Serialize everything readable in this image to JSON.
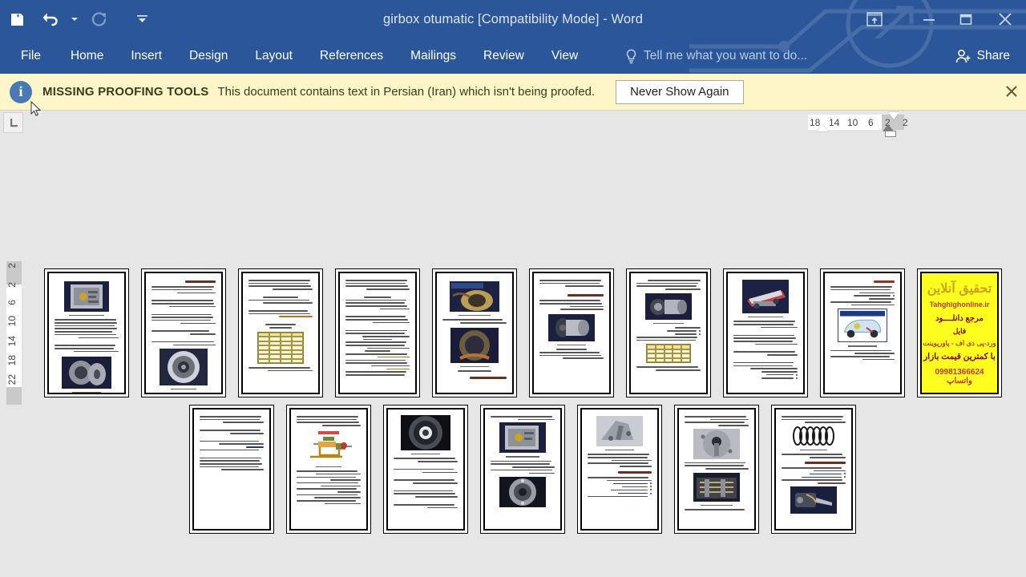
{
  "window": {
    "title": "girbox otumatic [Compatibility Mode] - Word",
    "quick_access": [
      {
        "name": "save",
        "icon": "save-icon",
        "label": "Save"
      },
      {
        "name": "undo",
        "icon": "undo-icon",
        "label": "Undo"
      },
      {
        "name": "undo-dropdown",
        "icon": "chevron-down-icon",
        "label": "Undo options"
      },
      {
        "name": "redo",
        "icon": "redo-icon",
        "label": "Redo"
      },
      {
        "name": "customize",
        "icon": "customize-qat-icon",
        "label": "Customize Quick Access Toolbar"
      }
    ],
    "controls": [
      {
        "name": "ribbon-display-options",
        "icon": "ribbon-display-icon",
        "label": "Ribbon Display Options"
      },
      {
        "name": "minimize",
        "icon": "minimize-icon",
        "label": "Minimize"
      },
      {
        "name": "restore",
        "icon": "restore-icon",
        "label": "Restore Down"
      },
      {
        "name": "close",
        "icon": "close-icon",
        "label": "Close"
      }
    ]
  },
  "ribbon": {
    "tabs": [
      {
        "label": "File"
      },
      {
        "label": "Home"
      },
      {
        "label": "Insert"
      },
      {
        "label": "Design"
      },
      {
        "label": "Layout"
      },
      {
        "label": "References"
      },
      {
        "label": "Mailings"
      },
      {
        "label": "Review"
      },
      {
        "label": "View"
      }
    ],
    "tellme": {
      "icon": "lightbulb-icon",
      "placeholder": "Tell me what you want to do..."
    },
    "share": {
      "icon": "share-person-icon",
      "label": "Share"
    }
  },
  "infobar": {
    "icon": "info-icon",
    "title": "MISSING PROOFING TOOLS",
    "message": "This document contains text in Persian (Iran) which isn't being proofed.",
    "button_label": "Never Show Again",
    "close_icon": "close-icon",
    "background": "#fdf6c9"
  },
  "rulers": {
    "tab_stop_selector": "left-tab-stop-icon",
    "horizontal_ticks": [
      "18",
      "14",
      "10",
      "6",
      "2",
      "2"
    ],
    "vertical_ticks": [
      "2",
      "2",
      "6",
      "10",
      "14",
      "18",
      "22"
    ]
  },
  "document": {
    "zoom_view": "multiple-pages",
    "rows": [
      {
        "pages": [
          {
            "n": 1,
            "kind": "text-2img",
            "images": 2
          },
          {
            "n": 2,
            "kind": "heading-text-img",
            "heading": true
          },
          {
            "n": 3,
            "kind": "text-table"
          },
          {
            "n": 4,
            "kind": "text-dense"
          },
          {
            "n": 5,
            "kind": "two-images-heading"
          },
          {
            "n": 6,
            "kind": "heading-text-img"
          },
          {
            "n": 7,
            "kind": "text-img-table"
          },
          {
            "n": 8,
            "kind": "img-text"
          },
          {
            "n": 9,
            "kind": "heading-text-diagram"
          },
          {
            "n": 10,
            "kind": "advertisement",
            "ad": true
          }
        ]
      },
      {
        "pages": [
          {
            "n": 11,
            "kind": "text-sparse"
          },
          {
            "n": 12,
            "kind": "text-flowdiagram"
          },
          {
            "n": 13,
            "kind": "img-text"
          },
          {
            "n": 14,
            "kind": "text-2img"
          },
          {
            "n": 15,
            "kind": "img-heading-bullets"
          },
          {
            "n": 16,
            "kind": "text-2img"
          },
          {
            "n": 17,
            "kind": "img-heading-bullets-img"
          }
        ]
      }
    ],
    "ad_page": {
      "line1": "تحقیق آنلاین",
      "line2": "Tahghighonline.ir",
      "line3": "مرجع دانلــــود",
      "line4": "فایل",
      "line5": "ورد-پی دی اف - پاورپوینت",
      "line6": "با کمترین قیمت بازار",
      "line7": "09981366624 واتساپ"
    }
  },
  "colors": {
    "titlebar": "#2b579a",
    "ribbon": "#2b579a",
    "workspace": "#e6e6e6",
    "infobar": "#fdf6c9",
    "page": "#ffffff",
    "ad": "#fdfd1e"
  }
}
